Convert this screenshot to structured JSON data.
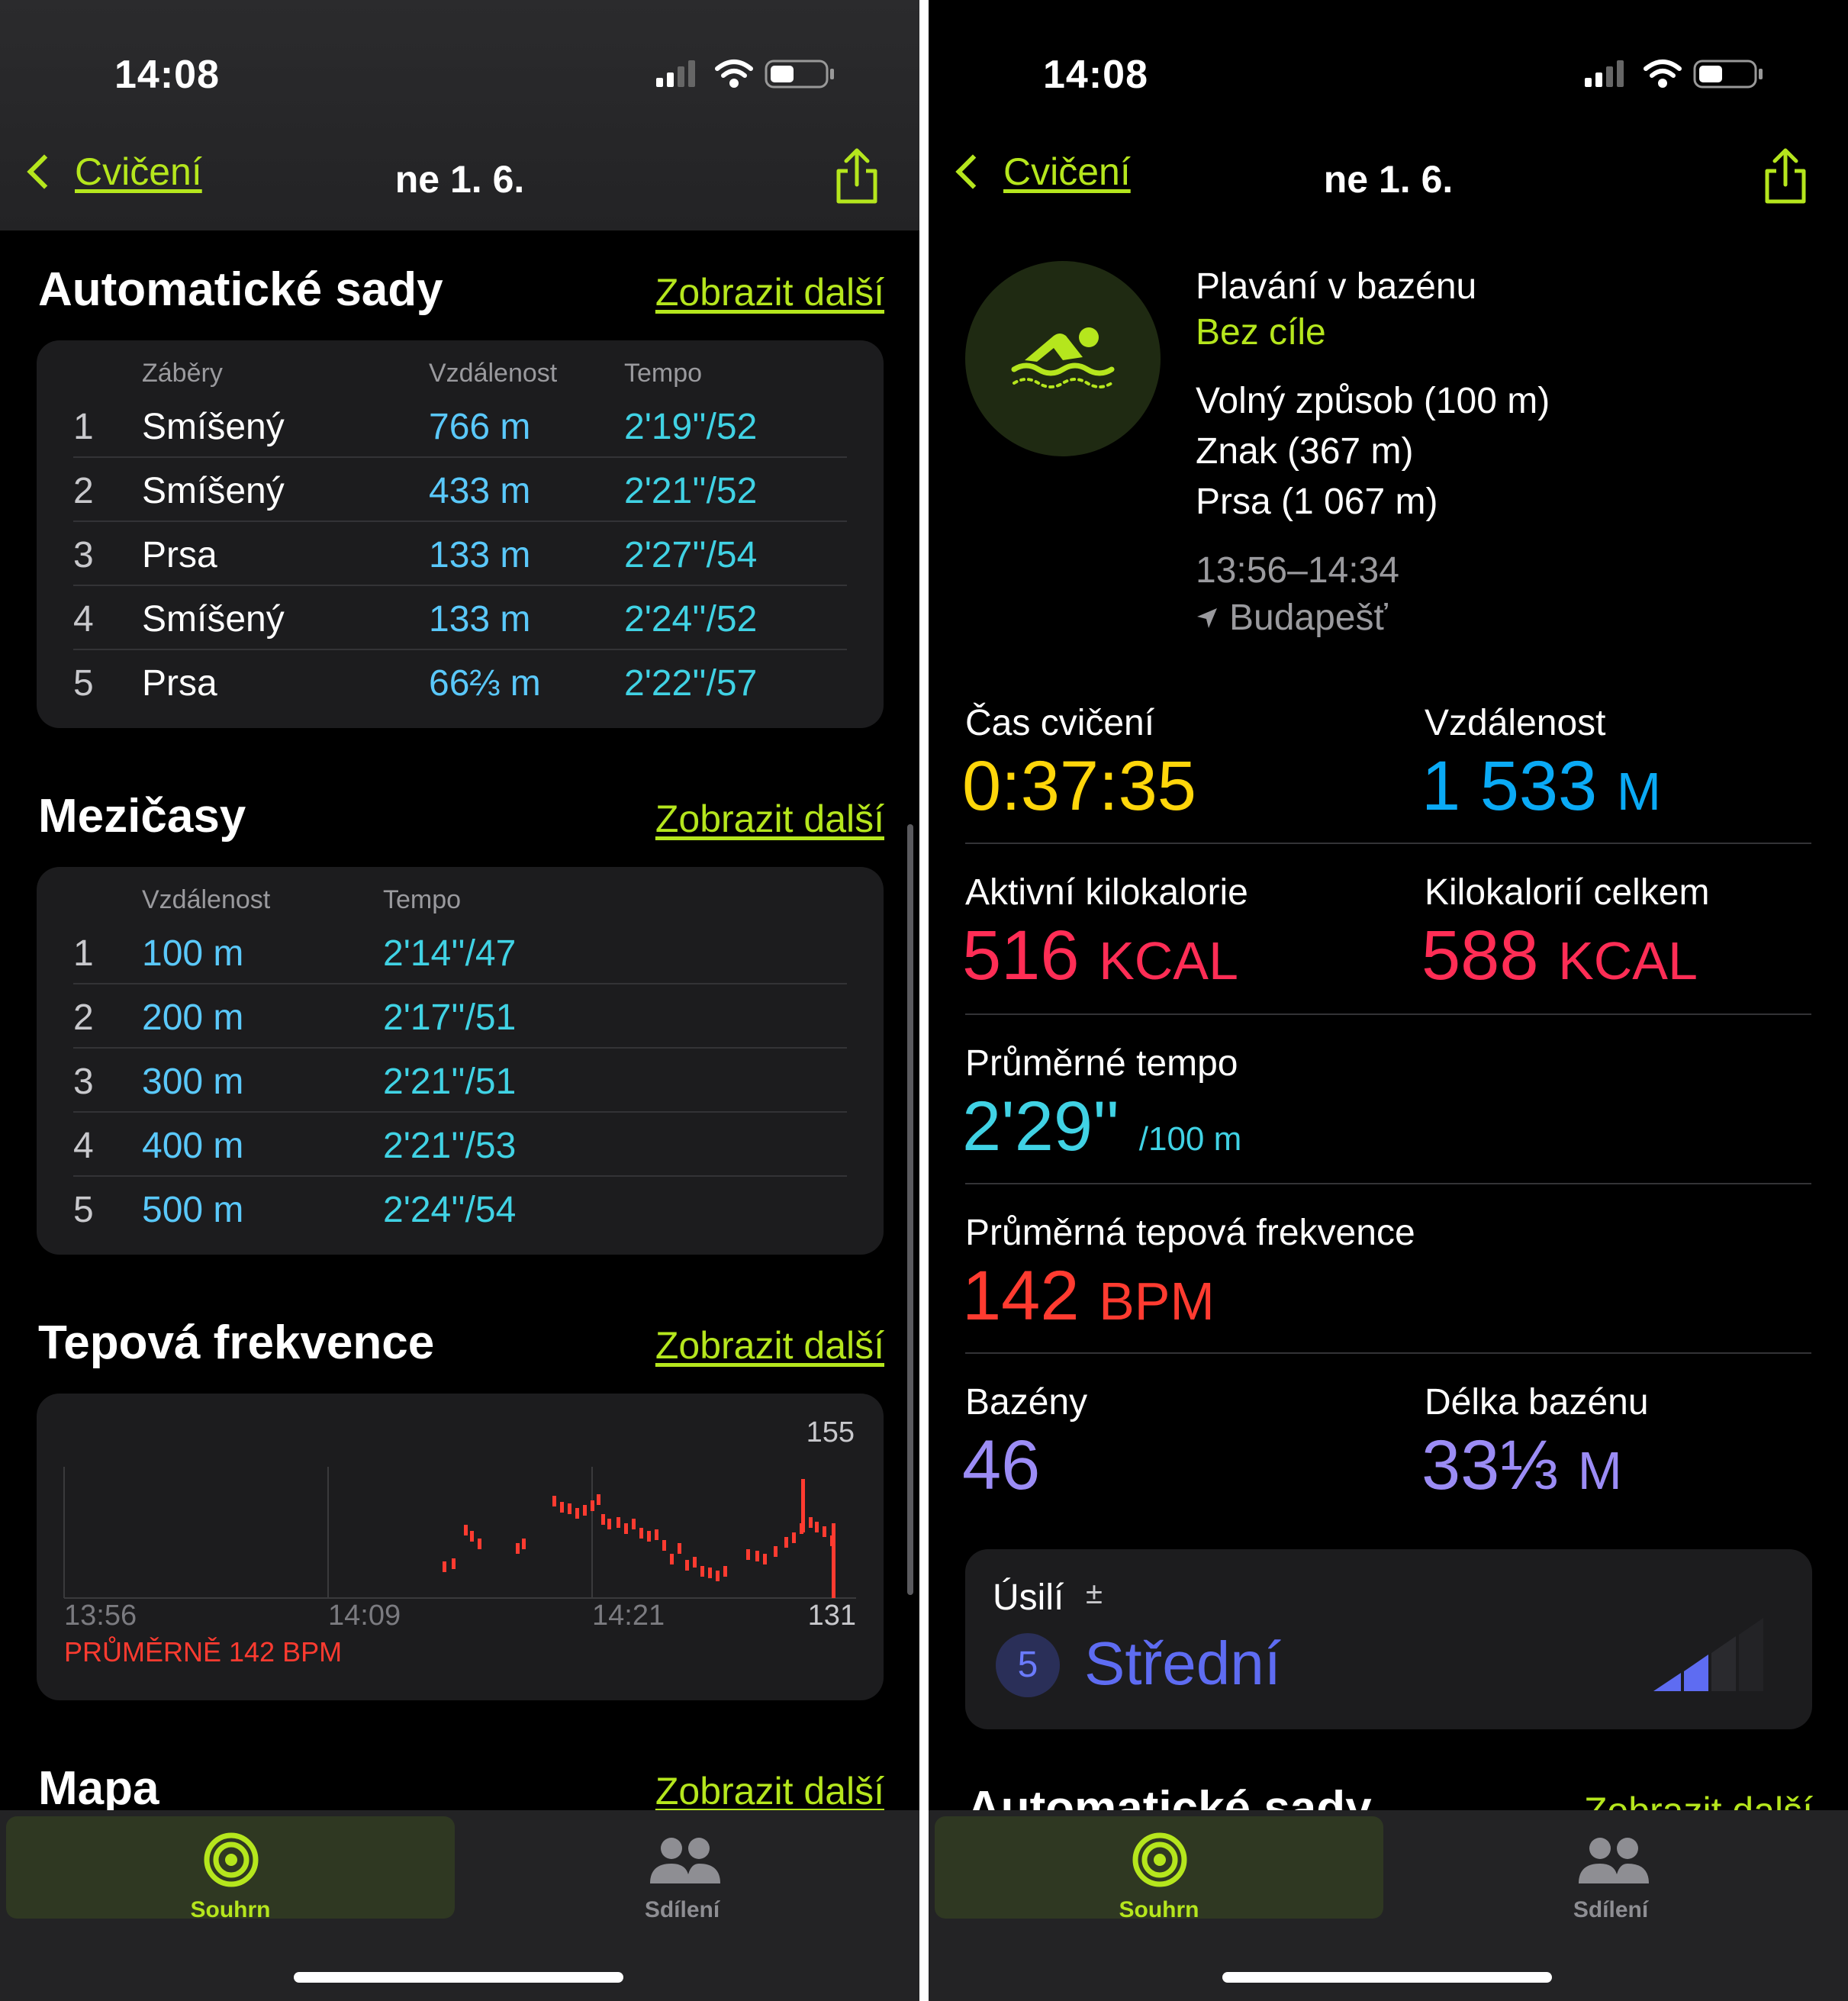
{
  "status": {
    "time": "14:08"
  },
  "nav": {
    "back_label": "Cvičení",
    "title": "ne 1. 6."
  },
  "left": {
    "auto_sets": {
      "title": "Automatické sady",
      "show_more": "Zobrazit další",
      "headers": [
        "Záběry",
        "Vzdálenost",
        "Tempo"
      ],
      "rows": [
        {
          "n": "1",
          "stroke": "Smíšený",
          "distance": "766 m",
          "pace": "2'19''/52"
        },
        {
          "n": "2",
          "stroke": "Smíšený",
          "distance": "433 m",
          "pace": "2'21''/52"
        },
        {
          "n": "3",
          "stroke": "Prsa",
          "distance": "133 m",
          "pace": "2'27''/54"
        },
        {
          "n": "4",
          "stroke": "Smíšený",
          "distance": "133 m",
          "pace": "2'24''/52"
        },
        {
          "n": "5",
          "stroke": "Prsa",
          "distance": "66⅔ m",
          "pace": "2'22''/57"
        }
      ]
    },
    "splits": {
      "title": "Mezičasy",
      "show_more": "Zobrazit další",
      "headers": [
        "Vzdálenost",
        "Tempo"
      ],
      "rows": [
        {
          "n": "1",
          "distance": "100 m",
          "pace": "2'14''/47"
        },
        {
          "n": "2",
          "distance": "200 m",
          "pace": "2'17''/51"
        },
        {
          "n": "3",
          "distance": "300 m",
          "pace": "2'21''/51"
        },
        {
          "n": "4",
          "distance": "400 m",
          "pace": "2'21''/53"
        },
        {
          "n": "5",
          "distance": "500 m",
          "pace": "2'24''/54"
        }
      ]
    },
    "heart_rate": {
      "title": "Tepová frekvence",
      "show_more": "Zobrazit další",
      "y_max": "155",
      "y_min": "131",
      "x_labels": [
        "13:56",
        "14:09",
        "14:21"
      ],
      "average": "PRŮMĚRNĚ 142 BPM",
      "color": "#ff3b30"
    },
    "map": {
      "title": "Mapa",
      "show_more": "Zobrazit další"
    }
  },
  "right": {
    "workout": {
      "type": "Plavání v bazénu",
      "goal": "Bez cíle",
      "strokes": [
        "Volný způsob (100 m)",
        "Znak (367 m)",
        "Prsa (1 067 m)"
      ],
      "time_range": "13:56–14:34",
      "location": "Budapešť",
      "icon": "swimmer-icon"
    },
    "metrics": {
      "time": {
        "label": "Čas cvičení",
        "value": "0:37:35",
        "color": "#ffd60a"
      },
      "distance": {
        "label": "Vzdálenost",
        "value": "1 533",
        "unit": "M",
        "color": "#0aaaf5"
      },
      "active_kcal": {
        "label": "Aktivní kilokalorie",
        "value": "516",
        "unit": "KCAL",
        "color": "#ff2d55"
      },
      "total_kcal": {
        "label": "Kilokalorií celkem",
        "value": "588",
        "unit": "KCAL",
        "color": "#ff2d55"
      },
      "pace": {
        "label": "Průměrné tempo",
        "value": "2'29''",
        "unit": "/100 m",
        "color": "#40d2e4"
      },
      "heart": {
        "label": "Průměrná tepová frekvence",
        "value": "142",
        "unit": "BPM",
        "color": "#ff3b30"
      },
      "pools": {
        "label": "Bazény",
        "value": "46",
        "color": "#9b8cf5"
      },
      "pool_length": {
        "label": "Délka bazénu",
        "value": "33⅓",
        "unit": "M",
        "color": "#9b8cf5"
      }
    },
    "effort": {
      "label": "Úsilí",
      "plusminus": "±",
      "score": "5",
      "value": "Střední",
      "color": "#5e6cf2"
    },
    "next_section": {
      "title": "Automatické sady",
      "show_more": "Zobrazit další"
    }
  },
  "tabs": {
    "summary": "Souhrn",
    "sharing": "Sdílení",
    "accent": "#b5e61d"
  }
}
